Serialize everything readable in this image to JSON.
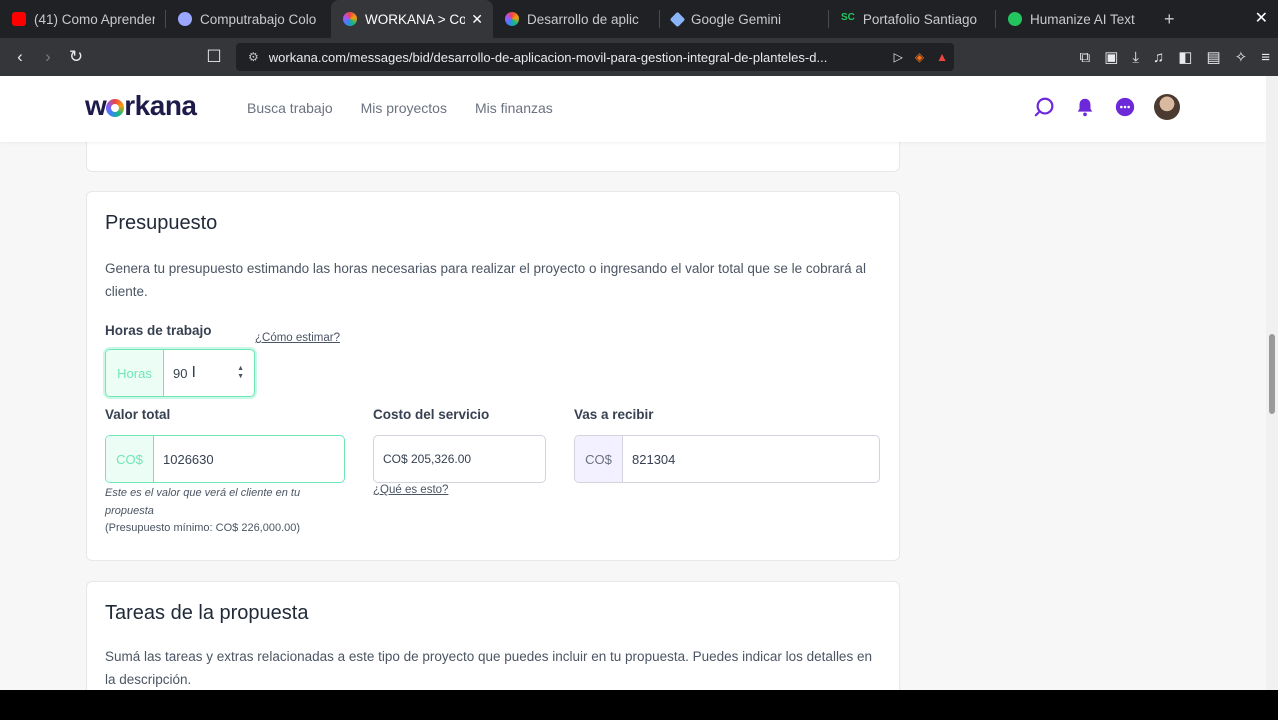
{
  "browser": {
    "tabs": [
      {
        "title": "(41) Como Aprender",
        "icon": "youtube-icon",
        "color": "#ff0000"
      },
      {
        "title": "Computrabajo Colo",
        "icon": "computrabajo-icon",
        "color": "#9aa7ff"
      },
      {
        "title": "WORKANA > Co",
        "icon": "workana-icon",
        "color": "#a855f7",
        "active": true
      },
      {
        "title": "Desarrollo de aplic",
        "icon": "workana-icon",
        "color": "#a855f7"
      },
      {
        "title": "Google Gemini",
        "icon": "gemini-icon",
        "color": "#8ab4f8"
      },
      {
        "title": "Portafolio Santiago",
        "icon": "sc-icon",
        "color": "#22c55e"
      },
      {
        "title": "Humanize AI Text",
        "icon": "humanize-icon",
        "color": "#22c55e"
      }
    ],
    "url": "workana.com/messages/bid/desarrollo-de-aplicacion-movil-para-gestion-integral-de-planteles-d..."
  },
  "header": {
    "logo": "workana",
    "nav": [
      "Busca trabajo",
      "Mis proyectos",
      "Mis finanzas"
    ]
  },
  "budget": {
    "title": "Presupuesto",
    "description": "Genera tu presupuesto estimando las horas necesarias para realizar el proyecto o ingresando el valor total que se le cobrará al cliente.",
    "hours_label": "Horas de trabajo",
    "how_estimate": "¿Cómo estimar?",
    "hours_prefix": "Horas",
    "hours_value": "90",
    "total_label": "Valor total",
    "total_prefix": "CO$",
    "total_value": "1026630",
    "total_note": "Este es el valor que verá el cliente en tu propuesta",
    "min_budget": "(Presupuesto mínimo: CO$ 226,000.00)",
    "service_label": "Costo del servicio",
    "service_value": "CO$ 205,326.00",
    "what_is_this": "¿Qué es esto?",
    "receive_label": "Vas a recibir",
    "receive_prefix": "CO$",
    "receive_value": "821304"
  },
  "tasks": {
    "title": "Tareas de la propuesta",
    "description": "Sumá las tareas y extras relacionadas a este tipo de proyecto que puedes incluir en tu propuesta. Puedes indicar los detalles en la descripción."
  }
}
